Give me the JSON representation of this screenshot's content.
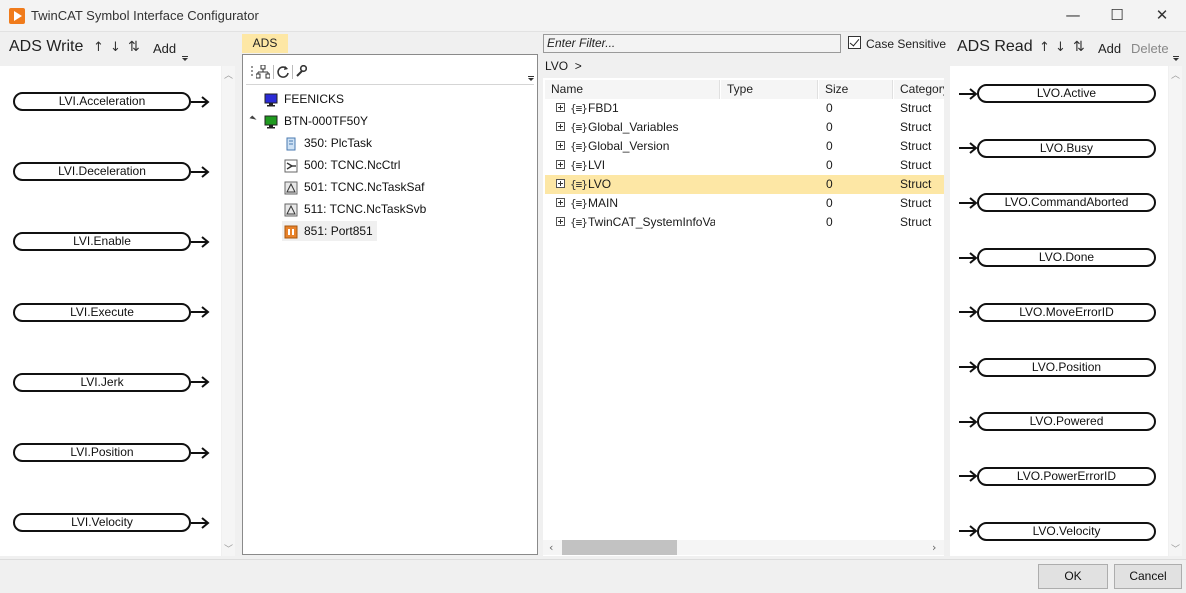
{
  "window": {
    "title": "TwinCAT Symbol Interface Configurator",
    "minimize": "—",
    "maximize": "☐",
    "close": "✕"
  },
  "ads_write": {
    "title": "ADS Write",
    "up": "↑",
    "down": "↓",
    "sort": "⇅",
    "add": "Add",
    "items": [
      "LVI.Acceleration",
      "LVI.Deceleration",
      "LVI.Enable",
      "LVI.Execute",
      "LVI.Jerk",
      "LVI.Position",
      "LVI.Velocity"
    ]
  },
  "ads_tree": {
    "tab": "ADS",
    "nodes": [
      {
        "label": "FEENICKS",
        "icon": "monitor-blue-icon"
      },
      {
        "label": "BTN-000TF50Y",
        "icon": "monitor-green-icon"
      },
      {
        "label": "350: PlcTask",
        "icon": "plc-task-icon"
      },
      {
        "label": "500: TCNC.NcCtrl",
        "icon": "nc-ctrl-icon"
      },
      {
        "label": "501: TCNC.NcTaskSaf",
        "icon": "nc-task-icon"
      },
      {
        "label": "511: TCNC.NcTaskSvb",
        "icon": "nc-task-icon"
      },
      {
        "label": "851: Port851",
        "icon": "port-icon"
      }
    ]
  },
  "symbols": {
    "filter_placeholder": "Enter Filter...",
    "case_sensitive": "Case Sensitive",
    "breadcrumb": "LVO  >",
    "columns": [
      "Name",
      "Type",
      "Size",
      "Category"
    ],
    "rows": [
      {
        "name": "FBD1",
        "type": "",
        "size": "0",
        "category": "Struct"
      },
      {
        "name": "Global_Variables",
        "type": "",
        "size": "0",
        "category": "Struct"
      },
      {
        "name": "Global_Version",
        "type": "",
        "size": "0",
        "category": "Struct"
      },
      {
        "name": "LVI",
        "type": "",
        "size": "0",
        "category": "Struct"
      },
      {
        "name": "LVO",
        "type": "",
        "size": "0",
        "category": "Struct"
      },
      {
        "name": "MAIN",
        "type": "",
        "size": "0",
        "category": "Struct"
      },
      {
        "name": "TwinCAT_SystemInfoVarList",
        "type": "",
        "size": "0",
        "category": "Struct"
      }
    ],
    "selected_row": "LVO"
  },
  "ads_read": {
    "title": "ADS Read",
    "up": "↑",
    "down": "↓",
    "sort": "⇅",
    "add": "Add",
    "delete": "Delete",
    "items": [
      "LVO.Active",
      "LVO.Busy",
      "LVO.CommandAborted",
      "LVO.Done",
      "LVO.MoveErrorID",
      "LVO.Position",
      "LVO.Powered",
      "LVO.PowerErrorID",
      "LVO.Velocity"
    ]
  },
  "footer": {
    "ok": "OK",
    "cancel": "Cancel"
  },
  "colors": {
    "selection": "#fde7a5",
    "brand_orange": "#f07b1b"
  }
}
